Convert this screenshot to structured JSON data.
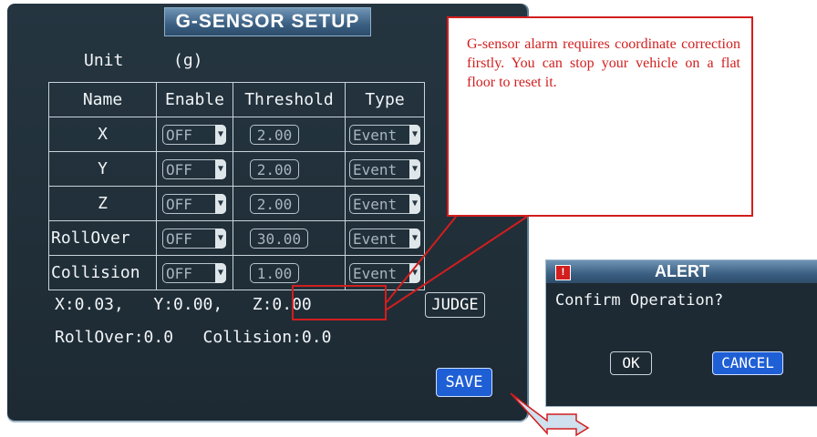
{
  "panel": {
    "title": "G-SENSOR SETUP",
    "unit_label": "Unit",
    "unit_value": "(g)",
    "columns": [
      "Name",
      "Enable",
      "Threshold",
      "Type"
    ],
    "rows": [
      {
        "name": "X",
        "enable": "OFF",
        "threshold": "2.00",
        "type": "Event"
      },
      {
        "name": "Y",
        "enable": "OFF",
        "threshold": "2.00",
        "type": "Event"
      },
      {
        "name": "Z",
        "enable": "OFF",
        "threshold": "2.00",
        "type": "Event"
      },
      {
        "name": "RollOver",
        "enable": "OFF",
        "threshold": "30.00",
        "type": "Event"
      },
      {
        "name": "Collision",
        "enable": "OFF",
        "threshold": "1.00",
        "type": "Event"
      }
    ],
    "readings_xyz": "X:0.03,   Y:0.00,   Z:0.00",
    "readings_other": "RollOver:0.0   Collision:0.0",
    "judge_label": "JUDGE",
    "save_label": "SAVE"
  },
  "callout": {
    "text": "G-sensor alarm requires coordinate correction firstly. You can stop your vehicle on a flat floor to reset it."
  },
  "alert": {
    "title": "ALERT",
    "message": "Confirm Operation?",
    "ok_label": "OK",
    "cancel_label": "CANCEL"
  },
  "colors": {
    "panel_bg": "#1d2a33",
    "title_bar": "#3a5f82",
    "button_blue": "#1f5fd6",
    "annotation_red": "#d21e1e"
  },
  "icons": {
    "dropdown": "chevron-down-icon",
    "alert": "warning-icon"
  }
}
